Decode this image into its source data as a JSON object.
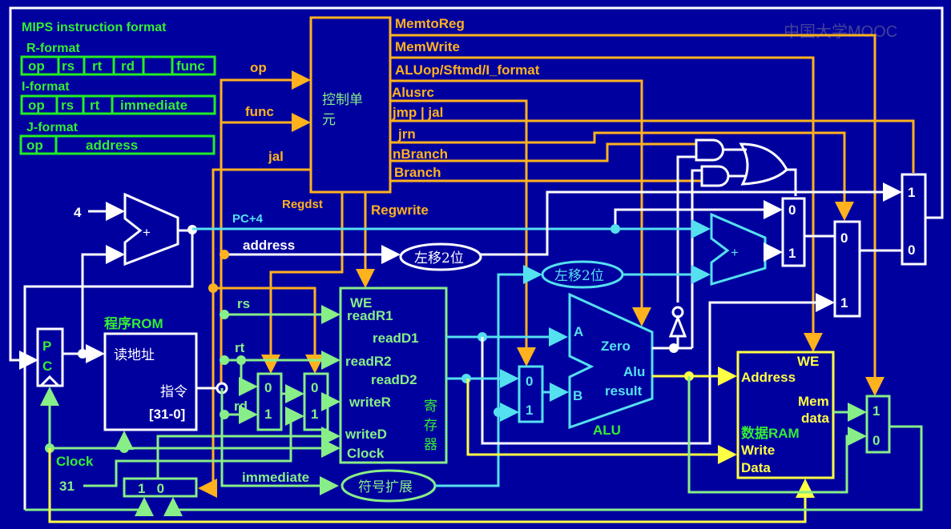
{
  "formats": {
    "title": "MIPS instruction format",
    "r": {
      "label": "R-format",
      "fields": [
        "op",
        "rs",
        "rt",
        "rd",
        "",
        "func"
      ]
    },
    "i": {
      "label": "I-format",
      "fields": [
        "op",
        "rs",
        "rt",
        "immediate"
      ]
    },
    "j": {
      "label": "J-format",
      "fields": [
        "op",
        "address"
      ]
    }
  },
  "control": {
    "title_line1": "控制单",
    "title_line2": "元",
    "inputs": {
      "op": "op",
      "func": "func",
      "jal": "jal"
    },
    "outputs": {
      "memtoreg": "MemtoReg",
      "memwrite": "MemWrite",
      "aluop": "ALUop/Sftmd/I_format",
      "alusrc": "Alusrc",
      "jmp": "jmp | jal",
      "jrn": "jrn",
      "nbranch": "nBranch",
      "branch": "Branch",
      "regdst": "Regdst",
      "regwrite": "Regwrite"
    }
  },
  "pc": {
    "label_p": "P",
    "label_c": "C",
    "const4": "4",
    "pc4": "PC+4",
    "address": "address",
    "clock": "Clock",
    "const31": "31"
  },
  "rom": {
    "title": "程序ROM",
    "read_addr": "读地址",
    "instr": "指令",
    "bits": "[31-0]"
  },
  "fields": {
    "rs": "rs",
    "rt": "rt",
    "rd": "rd",
    "immediate": "immediate"
  },
  "regfile": {
    "we": "WE",
    "readR1": "readR1",
    "readD1": "readD1",
    "readR2": "readR2",
    "readD2": "readD2",
    "writeR": "writeR",
    "writeD": "writeD",
    "clock": "Clock",
    "name": [
      "寄",
      "存",
      "器"
    ]
  },
  "shift1": "左移2位",
  "shift2": "左移2位",
  "signext": "符号扩展",
  "alu": {
    "a": "A",
    "b": "B",
    "zero": "Zero",
    "result1": "Alu",
    "result2": "result",
    "name": "ALU"
  },
  "ram": {
    "we": "WE",
    "address": "Address",
    "mem1": "Mem",
    "mem2": "data",
    "name": "数据RAM",
    "write": "Write",
    "data": "Data"
  },
  "muxes": {
    "zero": "0",
    "one": "1",
    "wb_box": "1   0"
  },
  "watermark": "中国大学MOOC",
  "colors": {
    "background": "#00009e",
    "control": "#ffb21e",
    "format": "#33ee33",
    "datapath": "#88ee88",
    "branch": "#55e0f0",
    "memory": "#ffff44"
  }
}
